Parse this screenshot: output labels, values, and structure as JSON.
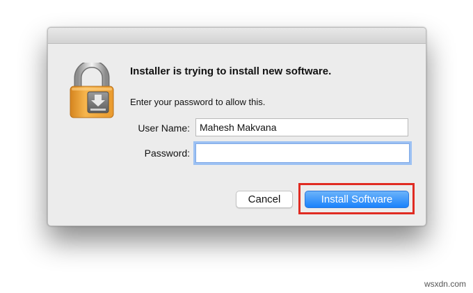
{
  "dialog": {
    "headline": "Installer is trying to install new software.",
    "subtext": "Enter your password to allow this.",
    "fields": {
      "user_label": "User Name:",
      "user_value": "Mahesh Makvana",
      "password_label": "Password:",
      "password_value": ""
    },
    "buttons": {
      "cancel_label": "Cancel",
      "install_label": "Install Software"
    },
    "icon": "padlock-installer-icon"
  },
  "colors": {
    "primary_button": "#1a82fb",
    "focus_ring": "#9cc1f3",
    "highlight_box": "#e02b22",
    "lock_body": "#f0a83a"
  },
  "watermark": "wsxdn.com"
}
